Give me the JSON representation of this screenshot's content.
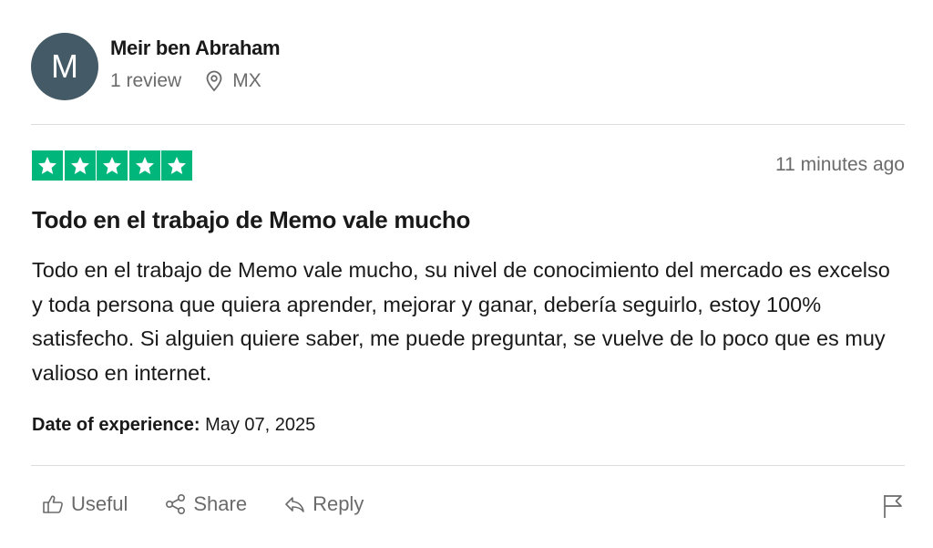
{
  "reviewer": {
    "avatar_initial": "M",
    "name": "Meir ben Abraham",
    "review_count": "1 review",
    "location": "MX"
  },
  "rating": {
    "stars": 5,
    "max": 5,
    "color": "#00b67a"
  },
  "timestamp": "11 minutes ago",
  "review": {
    "title": "Todo en el trabajo de Memo vale mucho",
    "body": "Todo en el trabajo de Memo vale mucho, su nivel de conocimiento del mercado es excelso y toda persona que quiera aprender, mejorar y ganar, debería seguirlo, estoy 100% satisfecho. Si alguien quiere saber, me puede preguntar, se vuelve de lo poco que es muy valioso en internet."
  },
  "experience": {
    "label": "Date of experience:",
    "date": "May 07, 2025"
  },
  "actions": {
    "useful_label": "Useful",
    "share_label": "Share",
    "reply_label": "Reply"
  },
  "icons": {
    "location": "map-pin-icon",
    "useful": "thumbs-up-icon",
    "share": "share-icon",
    "reply": "reply-icon",
    "report": "flag-icon"
  }
}
